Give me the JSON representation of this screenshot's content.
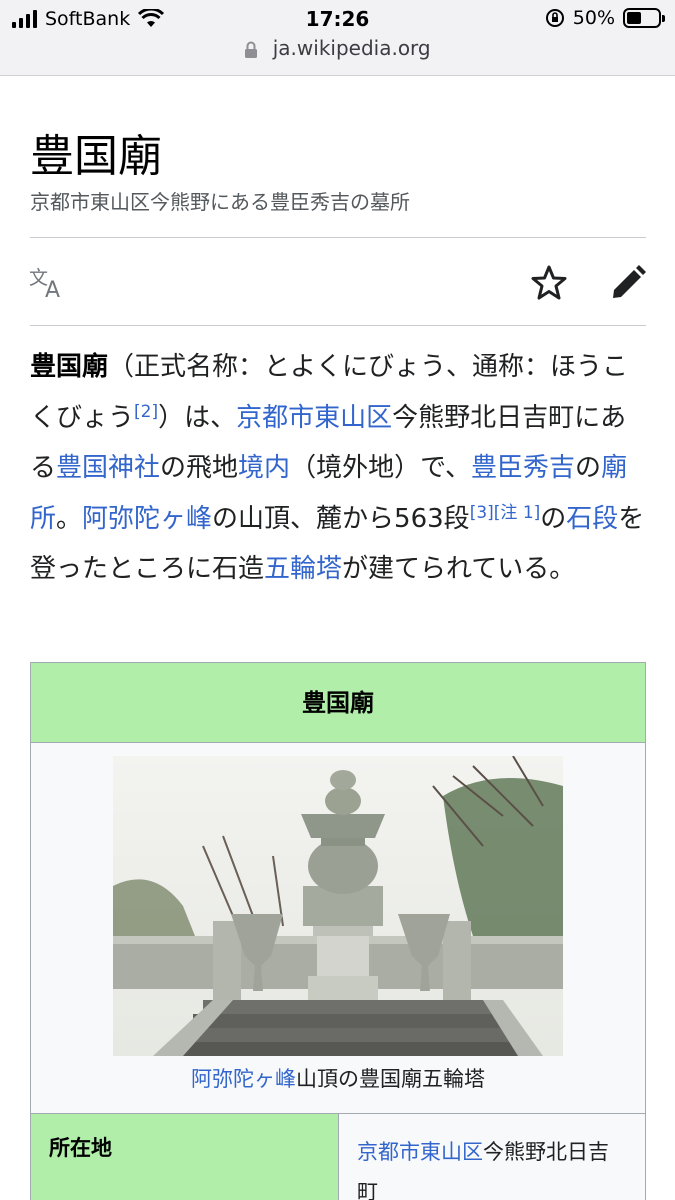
{
  "status": {
    "carrier": "SoftBank",
    "time": "17:26",
    "battery": "50%"
  },
  "url": "ja.wikipedia.org",
  "page": {
    "title": "豊国廟",
    "description": "京都市東山区今熊野にある豊臣秀吉の墓所"
  },
  "actions": {
    "language_icon": "language-icon",
    "star_icon": "star-icon",
    "edit_icon": "edit-pencil-icon"
  },
  "article": {
    "s1_bold": "豊国廟",
    "s2": "（正式名称：とよくにびょう、通称：ほうこくびょう",
    "ref2": "[2]",
    "s3": "）は、",
    "link_kyoto": "京都市東山区",
    "s4": "今熊野北日吉町にある",
    "link_jinja": "豊国神社",
    "s5": "の飛地",
    "link_keidai": "境内",
    "s6": "（境外地）で、",
    "link_hideyoshi": "豊臣秀吉",
    "s7": "の",
    "link_byosho": "廟所",
    "s8": "。",
    "link_amida": "阿弥陀ヶ峰",
    "s9": "の山頂、麓から563段",
    "ref3": "[3]",
    "note1": "[注 1]",
    "s10": "の",
    "link_ishidan": "石段",
    "s11": "を登ったところに石造",
    "link_gorinto": "五輪塔",
    "s12": "が建てられている。"
  },
  "infobox": {
    "header": "豊国廟",
    "caption_link": "阿弥陀ヶ峰",
    "caption_rest": "山頂の豊国廟五輪塔",
    "row_label": "所在地",
    "row_value_link": "京都市東山区",
    "row_value_rest": "今熊野北日吉町"
  },
  "colors": {
    "link": "#3366cc",
    "infobox_header": "#b0eeaa",
    "text": "#202122"
  }
}
